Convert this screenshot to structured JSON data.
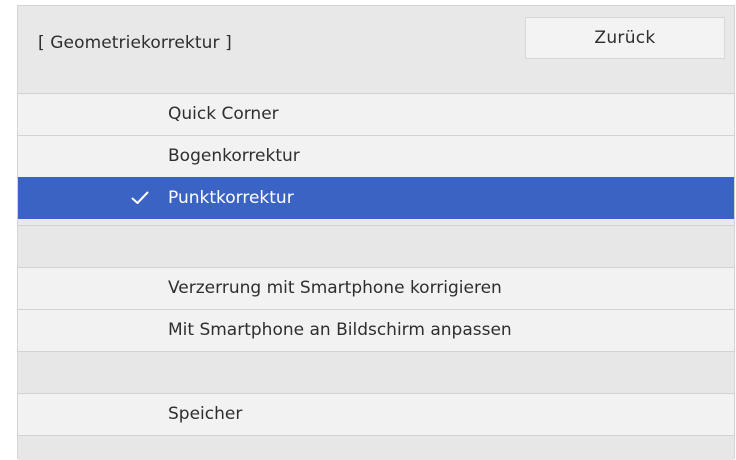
{
  "header": {
    "title": "[ Geometriekorrektur ]",
    "back_label": "Zurück"
  },
  "menu": {
    "items": [
      {
        "label": "Quick Corner",
        "selected": false
      },
      {
        "label": "Bogenkorrektur",
        "selected": false
      },
      {
        "label": "Punktkorrektur",
        "selected": true
      },
      {
        "label": "",
        "selected": false
      },
      {
        "label": "Verzerrung mit Smartphone korrigieren",
        "selected": false
      },
      {
        "label": "Mit Smartphone an Bildschirm anpassen",
        "selected": false
      },
      {
        "label": "",
        "selected": false
      },
      {
        "label": "Speicher",
        "selected": false
      }
    ]
  },
  "colors": {
    "selected_background": "#3b63c4",
    "selected_text": "#ffffff",
    "row_background": "#f2f2f2",
    "panel_background": "#e8e8e8"
  },
  "icons": {
    "selected_marker": "checkmark-icon"
  }
}
